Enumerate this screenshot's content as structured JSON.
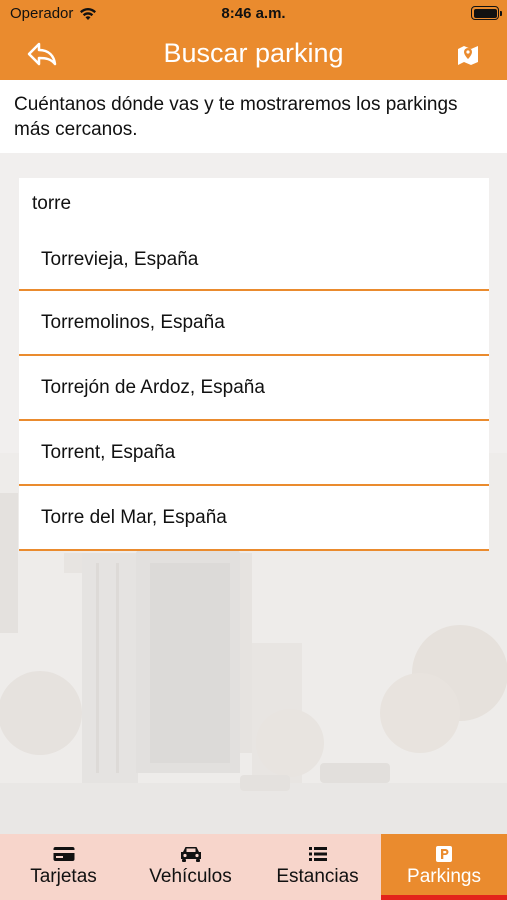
{
  "status_bar": {
    "carrier": "Operador",
    "time": "8:46 a.m."
  },
  "nav": {
    "title": "Buscar parking",
    "back_icon": "back-arrow-icon",
    "map_icon": "map-marker-icon"
  },
  "intro_text": "Cuéntanos dónde vas y te mostraremos los parkings más cercanos.",
  "search": {
    "value": "torre",
    "suggestions": [
      "Torrevieja, España",
      "Torremolinos, España",
      "Torrejón de Ardoz, España",
      "Torrent, España",
      "Torre del Mar, España"
    ]
  },
  "tabs": [
    {
      "label": "Tarjetas",
      "icon": "card-icon",
      "active": false
    },
    {
      "label": "Vehículos",
      "icon": "car-icon",
      "active": false
    },
    {
      "label": "Estancias",
      "icon": "list-icon",
      "active": false
    },
    {
      "label": "Parkings",
      "icon": "parking-icon",
      "active": true
    }
  ],
  "colors": {
    "accent": "#ea8b2e",
    "tabbar_bg": "#f7d5cb",
    "active_indicator": "#e3231b"
  }
}
